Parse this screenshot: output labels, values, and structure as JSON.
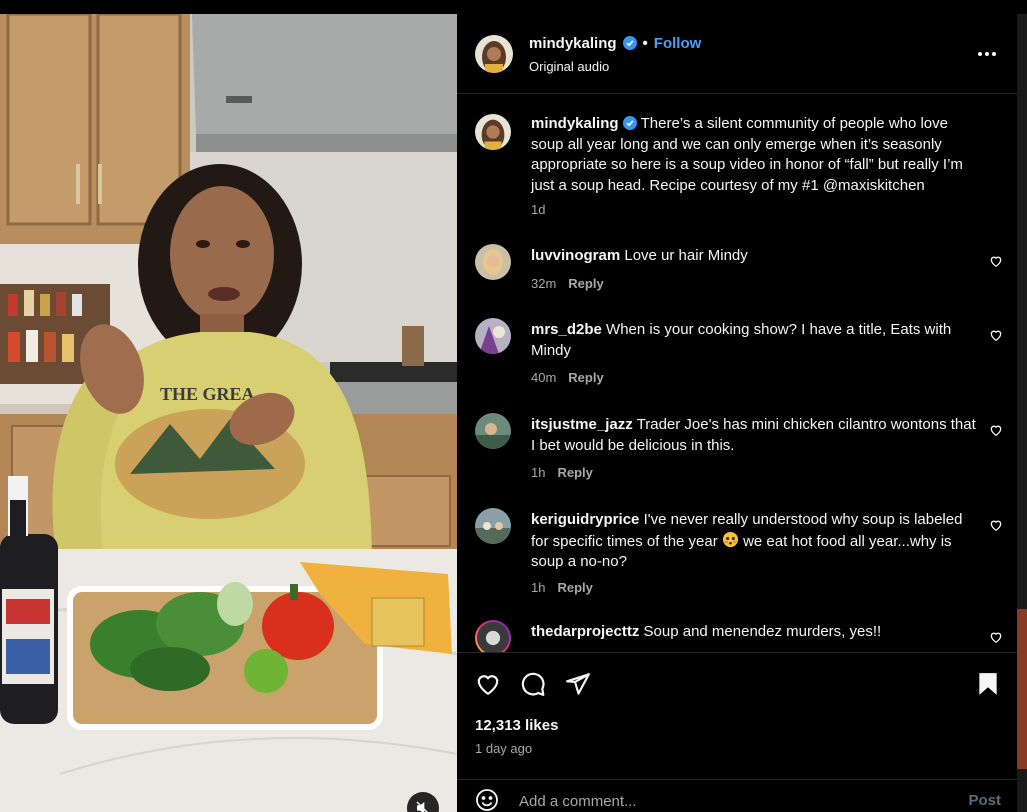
{
  "header": {
    "username": "mindykaling",
    "separator": "•",
    "follow_label": "Follow",
    "subtitle": "Original audio"
  },
  "caption": {
    "username": "mindykaling",
    "text": "There’s a silent community of people who love soup all year long and we can only emerge when it’s seasonly appropriate so here is a soup video in honor of “fall” but really I’m just a soup head. Recipe courtesy of my #1 @maxiskitchen",
    "time": "1d"
  },
  "comments": [
    {
      "username": "luvvinogram",
      "text": "Love ur hair Mindy",
      "time": "32m",
      "reply_label": "Reply"
    },
    {
      "username": "mrs_d2be",
      "text": "When is your cooking show? I have a title, Eats with Mindy",
      "time": "40m",
      "reply_label": "Reply"
    },
    {
      "username": "itsjustme_jazz",
      "text": "Trader Joe's has mini chicken cilantro wontons that I bet would be delicious in this.",
      "time": "1h",
      "reply_label": "Reply"
    },
    {
      "username": "keriguidryprice",
      "text": "I've never really understood why soup is labeled for specific times of the year",
      "text_after": "we eat hot food all year...why is soup a no-no?",
      "time": "1h",
      "reply_label": "Reply"
    },
    {
      "username": "thedarprojecttz",
      "text": "Soup and menendez murders, yes!!"
    }
  ],
  "actions": {
    "likes": "12,313 likes",
    "posted_ago": "1 day ago",
    "comment_placeholder": "Add a comment...",
    "post_label": "Post"
  },
  "colors": {
    "follow": "#4a9ef5",
    "verified": "#3797f0",
    "post_disabled": "#5b6a7d",
    "secondary_text": "#a8a8a8"
  },
  "icons": [
    "more-options-icon",
    "verified-badge-icon",
    "heart-icon",
    "comment-icon",
    "share-icon",
    "bookmark-icon",
    "emoji-icon",
    "muted-speaker-icon"
  ]
}
